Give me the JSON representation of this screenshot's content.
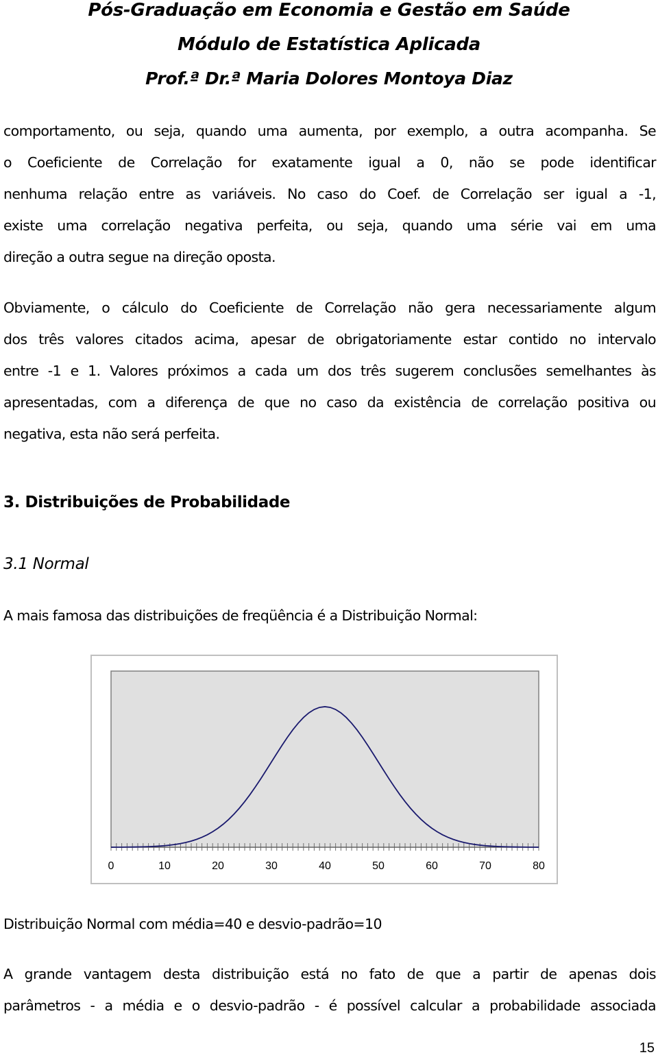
{
  "header": {
    "line1": "Pós-Graduação em Economia e Gestão em Saúde",
    "line2": "Módulo de Estatística Aplicada",
    "line3": "Prof.ª Dr.ª Maria Dolores Montoya Diaz"
  },
  "paragraph1": [
    "comportamento, ou seja, quando uma aumenta, por exemplo, a outra acompanha. Se",
    "o Coeficiente de Correlação for exatamente igual a 0, não se pode identificar",
    "nenhuma relação entre as variáveis. No caso do Coef. de Correlação ser igual a -1,",
    "existe uma correlação negativa perfeita, ou seja, quando uma série vai em uma",
    "direção a outra segue na direção oposta."
  ],
  "paragraph2": [
    "Obviamente, o cálculo do Coeficiente de Correlação não gera necessariamente algum",
    "dos três valores citados acima, apesar de obrigatoriamente estar contido no intervalo",
    "entre -1 e 1. Valores próximos a cada um dos três sugerem conclusões semelhantes às",
    "apresentadas, com a diferença de que no caso da existência de correlação positiva ou",
    "negativa, esta não será perfeita."
  ],
  "section_heading": "3.  Distribuições de Probabilidade",
  "subsection_heading": "3.1  Normal",
  "intro_sentence": "A mais famosa das distribuições de freqüência é a Distribuição Normal:",
  "chart_caption": "Distribuição Normal com média=40 e desvio-padrão=10",
  "paragraph3": [
    "A grande vantagem desta distribuição está no fato de que a partir de apenas dois",
    "parâmetros - a média e o desvio-padrão - é possível calcular a probabilidade associada"
  ],
  "page_number": "15",
  "colors": {
    "plot_background": "#e0e0e0",
    "curve": "#1a1a6e",
    "frame": "#bfbfbf"
  },
  "chart_data": {
    "type": "line",
    "title": "",
    "xlabel": "",
    "ylabel": "",
    "distribution": "normal",
    "mean": 40,
    "std_dev": 10,
    "x_range": [
      0,
      80
    ],
    "x_step": 1,
    "xlim": [
      0,
      80
    ],
    "ylim": [
      0,
      0.05
    ],
    "x_tick_labels": [
      "0",
      "10",
      "20",
      "30",
      "40",
      "50",
      "60",
      "70",
      "80"
    ],
    "x_tick_values": [
      0,
      10,
      20,
      30,
      40,
      50,
      60,
      70,
      80
    ],
    "minor_tick_interval": 1,
    "y_axis_visible": false,
    "grid": false,
    "legend": "none",
    "peak": {
      "x": 40,
      "y": 0.0399
    }
  }
}
